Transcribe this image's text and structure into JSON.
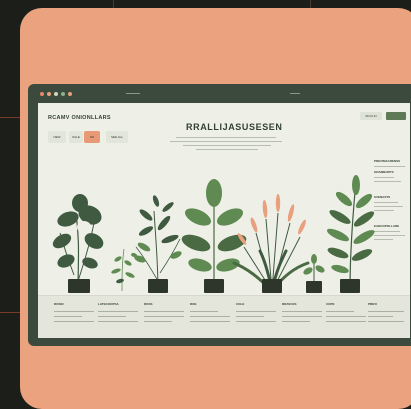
{
  "brand": {
    "name": "RCAMV ONIONLLARS"
  },
  "hero": {
    "headline": "RRALLIJASUSESEN"
  },
  "tabs": [
    {
      "label": "NEW"
    },
    {
      "label": "SALE"
    },
    {
      "label": "NO"
    },
    {
      "label": "SEE ALL"
    }
  ],
  "nav_right": [
    {
      "label": "SIGN IN"
    },
    {
      "label": ""
    }
  ],
  "sidebar": {
    "sections": [
      {
        "label": "PREVIMACRENSS"
      },
      {
        "label": "GRAMBORTS"
      },
      {
        "label": "SVENASTS"
      },
      {
        "label": "EANCOPOLLARE"
      }
    ]
  },
  "footer": {
    "columns": [
      {
        "heading": "ROSIN"
      },
      {
        "heading": "LATECOOPSA"
      },
      {
        "heading": "ROSS"
      },
      {
        "heading": "ROE"
      },
      {
        "heading": "COLE"
      },
      {
        "heading": "DRAVCES"
      },
      {
        "heading": "COPE"
      },
      {
        "heading": "PREVI"
      }
    ]
  },
  "colors": {
    "card": "#eba27e",
    "frame": "#3b4a3d",
    "screen": "#eef0e7",
    "accent": "#e89a76",
    "leaf_dark": "#3f5a41",
    "leaf_mid": "#5f8a52",
    "flower": "#e8a07f",
    "pot": "#2e362c"
  }
}
